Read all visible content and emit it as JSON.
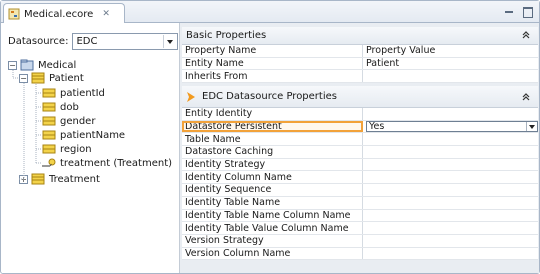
{
  "tab": {
    "title": "Medical.ecore",
    "close": "✕"
  },
  "datasource": {
    "label": "Datasource:",
    "value": "EDC"
  },
  "tree": {
    "root": "Medical",
    "patient": "Patient",
    "attributes": [
      "patientId",
      "dob",
      "gender",
      "patientName",
      "region"
    ],
    "reference": "treatment (Treatment)",
    "treatment": "Treatment",
    "expanded_sign": "−",
    "collapsed_sign": "+"
  },
  "basic": {
    "title": "Basic Properties",
    "headers": {
      "name": "Property Name",
      "value": "Property Value"
    },
    "rows": [
      {
        "name": "Entity Name",
        "value": "Patient"
      },
      {
        "name": "Inherits From",
        "value": ""
      }
    ]
  },
  "edc": {
    "title": "EDC Datasource Properties",
    "rows": [
      {
        "name": "Entity Identity",
        "value": ""
      },
      {
        "name": "Datastore Persistent",
        "value": "Yes"
      },
      {
        "name": "Table Name",
        "value": ""
      },
      {
        "name": "Datastore Caching",
        "value": ""
      },
      {
        "name": "Identity Strategy",
        "value": ""
      },
      {
        "name": "Identity Column Name",
        "value": ""
      },
      {
        "name": "Identity Sequence",
        "value": ""
      },
      {
        "name": "Identity Table Name",
        "value": ""
      },
      {
        "name": "Identity Table Name Column Name",
        "value": ""
      },
      {
        "name": "Identity Table Value Column Name",
        "value": ""
      },
      {
        "name": "Version Strategy",
        "value": ""
      },
      {
        "name": "Version Column Name",
        "value": ""
      }
    ]
  },
  "colors": {
    "accent_orange": "#f2a23a",
    "border": "#a8b6c8",
    "class_icon": "#e8c23a"
  },
  "icons": [
    "ecore-file-icon",
    "close-icon",
    "minimize-icon",
    "maximize-icon",
    "package-icon",
    "class-icon",
    "attribute-icon",
    "reference-icon",
    "collapse-icon",
    "chevron-right-icon",
    "dropdown-arrow-icon"
  ]
}
